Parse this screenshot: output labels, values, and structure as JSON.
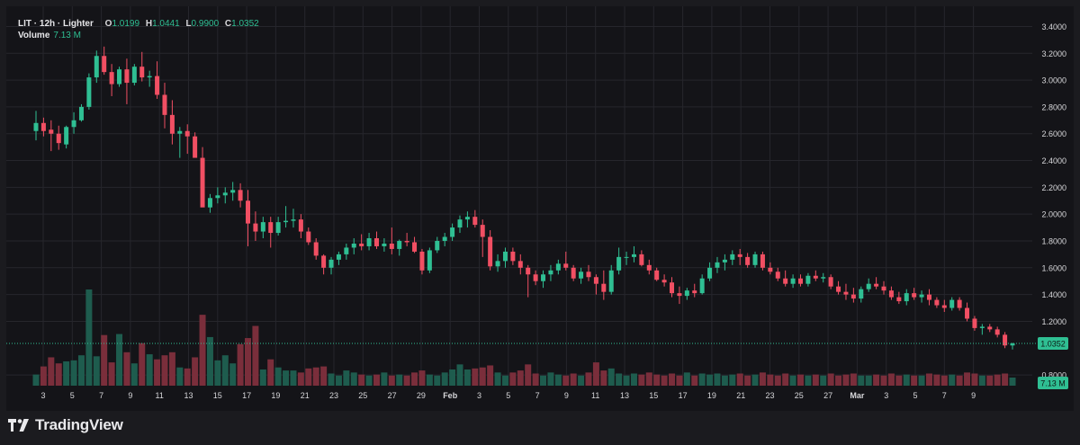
{
  "header": {
    "title": "LIT · 12h · Lighter",
    "open_label": "O",
    "open_value": "1.0199",
    "high_label": "H",
    "high_value": "1.0441",
    "low_label": "L",
    "low_value": "0.9900",
    "close_label": "C",
    "close_value": "1.0352",
    "volume_label": "Volume",
    "volume_value": "7.13 M"
  },
  "branding": {
    "name": "TradingView",
    "logo_icon": "tradingview-logo-icon"
  },
  "colors": {
    "background": "#141418",
    "grid": "#26262c",
    "up": "#2fbf93",
    "down": "#f14f63",
    "up_volume": "#1e5c4e",
    "down_volume": "#7a2e3b",
    "axis_text": "#d7d7da",
    "price_line": "#2fbf93"
  },
  "chart_data": {
    "type": "candlestick",
    "interval": "12h",
    "grid": true,
    "price_axis": {
      "position": "right",
      "ticks": [
        "3.4000",
        "3.2000",
        "3.0000",
        "2.8000",
        "2.6000",
        "2.4000",
        "2.2000",
        "2.0000",
        "1.8000",
        "1.6000",
        "1.4000",
        "1.2000",
        "0.8000"
      ],
      "range": [
        0.72,
        3.45
      ]
    },
    "time_axis": {
      "ticks": [
        "3",
        "5",
        "7",
        "9",
        "11",
        "13",
        "15",
        "17",
        "19",
        "21",
        "23",
        "25",
        "27",
        "29",
        "Feb",
        "3",
        "5",
        "7",
        "9",
        "11",
        "13",
        "15",
        "17",
        "19",
        "21",
        "23",
        "25",
        "27",
        "Mar",
        "3",
        "5",
        "7",
        "9"
      ]
    },
    "last_price_label": "1.0352",
    "last_volume_label": "7.13 M",
    "volume_max": 9.5,
    "candles": [
      [
        2.62,
        2.77,
        2.55,
        2.68,
        1.1
      ],
      [
        2.68,
        2.72,
        2.58,
        2.62,
        1.9
      ],
      [
        2.63,
        2.7,
        2.47,
        2.6,
        2.8
      ],
      [
        2.6,
        2.66,
        2.48,
        2.53,
        2.2
      ],
      [
        2.52,
        2.66,
        2.49,
        2.65,
        2.4
      ],
      [
        2.65,
        2.76,
        2.6,
        2.7,
        2.5
      ],
      [
        2.7,
        2.82,
        2.69,
        2.8,
        3.0
      ],
      [
        2.8,
        3.05,
        2.78,
        3.02,
        9.5
      ],
      [
        3.02,
        3.22,
        2.98,
        3.18,
        2.9
      ],
      [
        3.18,
        3.25,
        3.04,
        3.06,
        5.0
      ],
      [
        3.06,
        3.12,
        2.88,
        2.97,
        2.3
      ],
      [
        2.97,
        3.1,
        2.95,
        3.08,
        5.1
      ],
      [
        3.08,
        3.16,
        2.82,
        2.98,
        3.3
      ],
      [
        2.98,
        3.12,
        2.96,
        3.1,
        2.2
      ],
      [
        3.1,
        3.21,
        2.99,
        3.02,
        4.2
      ],
      [
        3.02,
        3.07,
        2.95,
        3.03,
        3.1
      ],
      [
        3.03,
        3.14,
        2.86,
        2.89,
        2.6
      ],
      [
        2.89,
        2.98,
        2.64,
        2.74,
        3.0
      ],
      [
        2.74,
        2.85,
        2.52,
        2.6,
        3.3
      ],
      [
        2.6,
        2.65,
        2.42,
        2.62,
        1.8
      ],
      [
        2.62,
        2.67,
        2.45,
        2.58,
        1.7
      ],
      [
        2.58,
        2.61,
        2.45,
        2.42,
        2.8
      ],
      [
        2.42,
        2.5,
        2.1,
        2.05,
        7.0
      ],
      [
        2.05,
        2.15,
        2.01,
        2.12,
        4.8
      ],
      [
        2.12,
        2.2,
        2.08,
        2.14,
        2.5
      ],
      [
        2.14,
        2.2,
        2.08,
        2.16,
        3.0
      ],
      [
        2.16,
        2.24,
        2.1,
        2.18,
        2.2
      ],
      [
        2.18,
        2.23,
        2.05,
        2.1,
        4.1
      ],
      [
        2.1,
        2.18,
        1.76,
        1.93,
        4.7
      ],
      [
        1.93,
        2.02,
        1.8,
        1.87,
        5.9
      ],
      [
        1.87,
        1.98,
        1.82,
        1.94,
        1.6
      ],
      [
        1.94,
        1.98,
        1.75,
        1.86,
        2.6
      ],
      [
        1.86,
        1.98,
        1.84,
        1.94,
        1.8
      ],
      [
        1.94,
        2.06,
        1.9,
        1.95,
        1.5
      ],
      [
        1.95,
        2.04,
        1.9,
        1.96,
        1.5
      ],
      [
        1.96,
        2.0,
        1.82,
        1.87,
        1.3
      ],
      [
        1.87,
        1.9,
        1.77,
        1.79,
        1.7
      ],
      [
        1.79,
        1.82,
        1.66,
        1.69,
        1.8
      ],
      [
        1.69,
        1.7,
        1.55,
        1.6,
        1.9
      ],
      [
        1.6,
        1.68,
        1.55,
        1.66,
        1.2
      ],
      [
        1.66,
        1.72,
        1.62,
        1.7,
        1.0
      ],
      [
        1.7,
        1.78,
        1.66,
        1.75,
        1.5
      ],
      [
        1.75,
        1.82,
        1.7,
        1.78,
        1.3
      ],
      [
        1.78,
        1.85,
        1.73,
        1.76,
        1.1
      ],
      [
        1.76,
        1.86,
        1.73,
        1.82,
        1.0
      ],
      [
        1.82,
        1.87,
        1.74,
        1.76,
        1.1
      ],
      [
        1.76,
        1.82,
        1.72,
        1.78,
        1.3
      ],
      [
        1.78,
        1.9,
        1.7,
        1.74,
        1.0
      ],
      [
        1.74,
        1.81,
        1.69,
        1.8,
        1.1
      ],
      [
        1.8,
        1.86,
        1.76,
        1.79,
        1.0
      ],
      [
        1.79,
        1.83,
        1.71,
        1.72,
        1.3
      ],
      [
        1.72,
        1.74,
        1.55,
        1.58,
        1.5
      ],
      [
        1.58,
        1.75,
        1.56,
        1.73,
        1.1
      ],
      [
        1.73,
        1.83,
        1.71,
        1.8,
        1.0
      ],
      [
        1.8,
        1.86,
        1.76,
        1.83,
        1.3
      ],
      [
        1.83,
        1.93,
        1.8,
        1.9,
        1.6
      ],
      [
        1.9,
        1.99,
        1.86,
        1.96,
        2.1
      ],
      [
        1.96,
        2.02,
        1.9,
        1.98,
        1.6
      ],
      [
        1.98,
        2.03,
        1.9,
        1.92,
        1.7
      ],
      [
        1.92,
        1.96,
        1.68,
        1.83,
        1.8
      ],
      [
        1.83,
        1.88,
        1.58,
        1.61,
        2.0
      ],
      [
        1.61,
        1.7,
        1.57,
        1.65,
        1.3
      ],
      [
        1.65,
        1.75,
        1.6,
        1.72,
        1.0
      ],
      [
        1.72,
        1.75,
        1.62,
        1.65,
        1.3
      ],
      [
        1.65,
        1.7,
        1.55,
        1.6,
        1.5
      ],
      [
        1.6,
        1.62,
        1.38,
        1.55,
        2.1
      ],
      [
        1.55,
        1.58,
        1.47,
        1.5,
        1.2
      ],
      [
        1.5,
        1.58,
        1.45,
        1.55,
        1.0
      ],
      [
        1.55,
        1.62,
        1.5,
        1.58,
        1.3
      ],
      [
        1.58,
        1.66,
        1.55,
        1.63,
        1.1
      ],
      [
        1.63,
        1.72,
        1.58,
        1.6,
        1.0
      ],
      [
        1.6,
        1.62,
        1.5,
        1.52,
        1.2
      ],
      [
        1.52,
        1.6,
        1.48,
        1.57,
        1.0
      ],
      [
        1.57,
        1.62,
        1.5,
        1.53,
        1.3
      ],
      [
        1.53,
        1.55,
        1.4,
        1.48,
        2.3
      ],
      [
        1.48,
        1.58,
        1.36,
        1.42,
        1.5
      ],
      [
        1.42,
        1.62,
        1.4,
        1.58,
        1.7
      ],
      [
        1.58,
        1.75,
        1.55,
        1.68,
        1.2
      ],
      [
        1.68,
        1.72,
        1.62,
        1.68,
        1.0
      ],
      [
        1.68,
        1.76,
        1.64,
        1.7,
        1.2
      ],
      [
        1.7,
        1.73,
        1.61,
        1.62,
        1.1
      ],
      [
        1.62,
        1.66,
        1.55,
        1.58,
        1.3
      ],
      [
        1.58,
        1.6,
        1.5,
        1.51,
        1.1
      ],
      [
        1.51,
        1.55,
        1.46,
        1.49,
        1.0
      ],
      [
        1.49,
        1.53,
        1.38,
        1.41,
        1.2
      ],
      [
        1.41,
        1.46,
        1.33,
        1.39,
        1.0
      ],
      [
        1.39,
        1.45,
        1.36,
        1.43,
        1.3
      ],
      [
        1.43,
        1.48,
        1.38,
        1.41,
        1.0
      ],
      [
        1.41,
        1.55,
        1.4,
        1.52,
        1.2
      ],
      [
        1.52,
        1.64,
        1.5,
        1.6,
        1.1
      ],
      [
        1.6,
        1.68,
        1.56,
        1.64,
        1.2
      ],
      [
        1.64,
        1.7,
        1.58,
        1.66,
        1.0
      ],
      [
        1.66,
        1.73,
        1.62,
        1.7,
        1.1
      ],
      [
        1.7,
        1.74,
        1.62,
        1.68,
        1.2
      ],
      [
        1.68,
        1.71,
        1.6,
        1.62,
        1.0
      ],
      [
        1.62,
        1.72,
        1.6,
        1.7,
        1.1
      ],
      [
        1.7,
        1.72,
        1.58,
        1.6,
        1.3
      ],
      [
        1.6,
        1.64,
        1.55,
        1.57,
        1.1
      ],
      [
        1.57,
        1.6,
        1.5,
        1.52,
        1.0
      ],
      [
        1.52,
        1.58,
        1.46,
        1.48,
        1.2
      ],
      [
        1.48,
        1.55,
        1.45,
        1.52,
        1.0
      ],
      [
        1.52,
        1.55,
        1.46,
        1.48,
        1.1
      ],
      [
        1.48,
        1.56,
        1.46,
        1.54,
        1.0
      ],
      [
        1.54,
        1.58,
        1.5,
        1.52,
        1.1
      ],
      [
        1.52,
        1.56,
        1.49,
        1.53,
        1.0
      ],
      [
        1.53,
        1.55,
        1.44,
        1.46,
        1.2
      ],
      [
        1.46,
        1.5,
        1.4,
        1.42,
        1.0
      ],
      [
        1.42,
        1.48,
        1.36,
        1.4,
        1.1
      ],
      [
        1.4,
        1.45,
        1.34,
        1.37,
        1.2
      ],
      [
        1.37,
        1.46,
        1.34,
        1.44,
        1.0
      ],
      [
        1.44,
        1.52,
        1.42,
        1.48,
        1.0
      ],
      [
        1.48,
        1.53,
        1.44,
        1.46,
        1.1
      ],
      [
        1.46,
        1.5,
        1.4,
        1.43,
        1.0
      ],
      [
        1.43,
        1.46,
        1.36,
        1.38,
        1.2
      ],
      [
        1.38,
        1.42,
        1.33,
        1.35,
        1.0
      ],
      [
        1.35,
        1.44,
        1.32,
        1.41,
        1.1
      ],
      [
        1.41,
        1.45,
        1.36,
        1.38,
        1.0
      ],
      [
        1.38,
        1.43,
        1.34,
        1.4,
        1.0
      ],
      [
        1.4,
        1.44,
        1.32,
        1.36,
        1.2
      ],
      [
        1.36,
        1.38,
        1.3,
        1.32,
        1.1
      ],
      [
        1.32,
        1.36,
        1.27,
        1.3,
        1.0
      ],
      [
        1.3,
        1.38,
        1.28,
        1.36,
        1.1
      ],
      [
        1.36,
        1.38,
        1.28,
        1.3,
        1.0
      ],
      [
        1.3,
        1.34,
        1.2,
        1.22,
        1.3
      ],
      [
        1.22,
        1.24,
        1.13,
        1.15,
        1.2
      ],
      [
        1.15,
        1.18,
        1.1,
        1.16,
        1.0
      ],
      [
        1.16,
        1.18,
        1.12,
        1.14,
        1.0
      ],
      [
        1.14,
        1.16,
        1.08,
        1.1,
        1.1
      ],
      [
        1.1,
        1.12,
        1.0,
        1.02,
        1.2
      ],
      [
        1.02,
        1.04,
        0.99,
        1.035,
        0.8
      ]
    ]
  }
}
